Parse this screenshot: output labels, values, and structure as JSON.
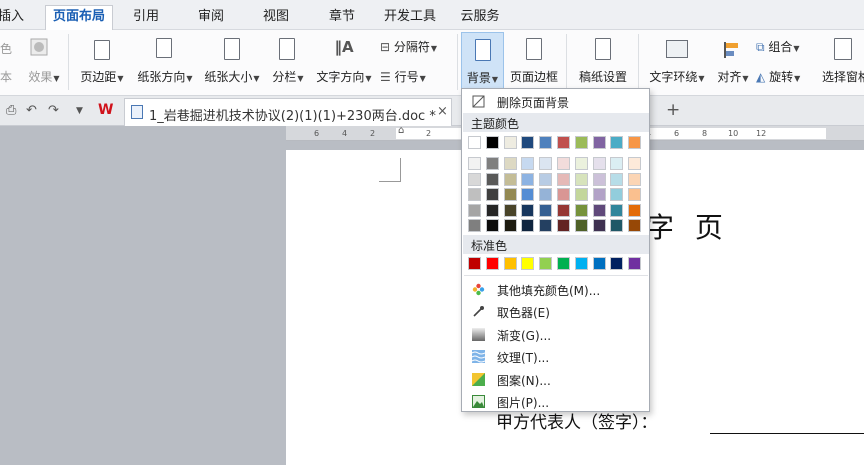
{
  "menubar": {
    "tabs": [
      "插入",
      "页面布局",
      "引用",
      "审阅",
      "视图",
      "章节",
      "开发工具",
      "云服务"
    ],
    "active": "页面布局"
  },
  "ribbon": {
    "left_partial": {
      "top": "色",
      "bottom": "本",
      "effect": "效果"
    },
    "margins": "页边距",
    "orientation": "纸张方向",
    "size": "纸张大小",
    "columns": "分栏",
    "text_direction": "文字方向",
    "separator": "分隔符",
    "line_number": "行号",
    "background": "背景",
    "page_border": "页面边框",
    "draft_paper": "稿纸设置",
    "text_wrap": "文字环绕",
    "align": "对齐",
    "group": "组合",
    "rotate": "旋转",
    "selection_pane": "选择窗格"
  },
  "tabbar": {
    "doc_title": "1_岩巷掘进机技术协议(2)(1)(1)+230两台.doc *",
    "new_tab": "+"
  },
  "ruler": {
    "ticks": [
      "6",
      "4",
      "2",
      "2",
      "4",
      "6",
      "8",
      "10",
      "12"
    ]
  },
  "document": {
    "heading": "字  页",
    "signature_line": "甲方代表人（签字）："
  },
  "dropdown": {
    "remove_background": "删除页面背景",
    "theme_colors_label": "主题颜色",
    "theme_top_row": [
      "#ffffff",
      "#000000",
      "#eeece1",
      "#1f497d",
      "#4f81bd",
      "#c0504d",
      "#9bbb59",
      "#8064a2",
      "#4bacc6",
      "#f79646"
    ],
    "theme_shades": [
      [
        "#f2f2f2",
        "#7f7f7f",
        "#ddd9c3",
        "#c6d9f0",
        "#dbe5f1",
        "#f2dcdb",
        "#ebf1dd",
        "#e5e0ec",
        "#dbeef3",
        "#fdeada"
      ],
      [
        "#d8d8d8",
        "#595959",
        "#c4bd97",
        "#8db3e2",
        "#b8cce4",
        "#e5b9b7",
        "#d7e3bc",
        "#ccc1d9",
        "#b7dde8",
        "#fbd5b5"
      ],
      [
        "#bfbfbf",
        "#3f3f3f",
        "#938953",
        "#548dd4",
        "#95b3d7",
        "#d99694",
        "#c3d69b",
        "#b2a2c7",
        "#92cddc",
        "#fac08f"
      ],
      [
        "#a5a5a5",
        "#262626",
        "#494429",
        "#17365d",
        "#366092",
        "#953734",
        "#76923c",
        "#5f497a",
        "#31859b",
        "#e36c09"
      ],
      [
        "#7f7f7f",
        "#0c0c0c",
        "#1d1b10",
        "#0f243e",
        "#244061",
        "#632423",
        "#4f6128",
        "#3f3151",
        "#205867",
        "#974806"
      ]
    ],
    "standard_colors_label": "标准色",
    "standard_colors": [
      "#c00000",
      "#ff0000",
      "#ffc000",
      "#ffff00",
      "#92d050",
      "#00b050",
      "#00b0f0",
      "#0070c0",
      "#002060",
      "#7030a0"
    ],
    "more_fill": "其他填充颜色(M)...",
    "eyedropper": "取色器(E)",
    "gradient": "渐变(G)...",
    "texture": "纹理(T)...",
    "pattern": "图案(N)...",
    "picture": "图片(P)..."
  }
}
